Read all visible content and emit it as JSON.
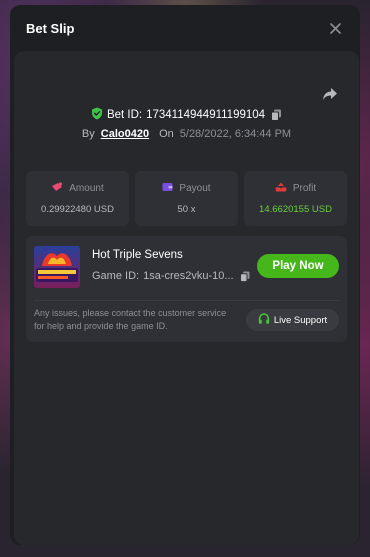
{
  "modal": {
    "title": "Bet Slip"
  },
  "bet": {
    "id_label": "Bet ID:",
    "id_value": "1734114944911199104",
    "by_label": "By",
    "username": "Calo0420",
    "on_label": "On",
    "datetime": "5/28/2022, 6:34:44 PM"
  },
  "stats": [
    {
      "label": "Amount",
      "value": "0.29922480 USD",
      "icon": "coins-icon",
      "color": "#e84a72"
    },
    {
      "label": "Payout",
      "value": "50 x",
      "icon": "wallet-icon",
      "color": "#7a4fe0"
    },
    {
      "label": "Profit",
      "value": "14.6620155 USD",
      "icon": "profit-icon",
      "color": "#e03a3a"
    }
  ],
  "game": {
    "name": "Hot Triple Sevens",
    "id_label": "Game ID:",
    "id_value": "1sa-cres2vku-10...",
    "play_label": "Play Now"
  },
  "support": {
    "text": "Any issues, please contact the customer service for help and provide the game ID.",
    "button_label": "Live Support"
  },
  "colors": {
    "accent_green": "#46b71b",
    "profit_green": "#6bd13a"
  }
}
